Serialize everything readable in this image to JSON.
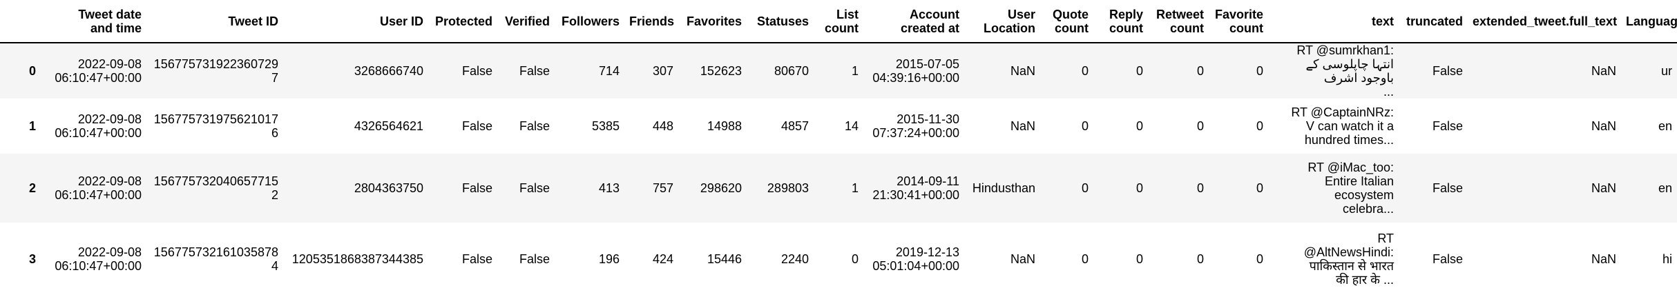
{
  "columns": {
    "index": "",
    "tweet_date": [
      "Tweet date",
      "and time"
    ],
    "tweet_id": "Tweet ID",
    "user_id": "User ID",
    "protected": "Protected",
    "verified": "Verified",
    "followers": "Followers",
    "friends": "Friends",
    "favorites": "Favorites",
    "statuses": "Statuses",
    "list_count": [
      "List",
      "count"
    ],
    "account_created": [
      "Account",
      "created at"
    ],
    "user_location": [
      "User",
      "Location"
    ],
    "quote_count": [
      "Quote",
      "count"
    ],
    "reply_count": [
      "Reply",
      "count"
    ],
    "retweet_count": [
      "Retweet",
      "count"
    ],
    "favorite_count": [
      "Favorite",
      "count"
    ],
    "text": "text",
    "truncated": "truncated",
    "extended_tweet": "extended_tweet.full_text",
    "language": "Language"
  },
  "rows": [
    {
      "index": "0",
      "tweet_date": [
        "2022-09-08",
        "06:10:47+00:00"
      ],
      "tweet_id": "1567757319223607297",
      "user_id": "3268666740",
      "protected": "False",
      "verified": "False",
      "followers": "714",
      "friends": "307",
      "favorites": "152623",
      "statuses": "80670",
      "list_count": "1",
      "account_created": [
        "2015-07-05",
        "04:39:16+00:00"
      ],
      "user_location": "NaN",
      "quote_count": "0",
      "reply_count": "0",
      "retweet_count": "0",
      "favorite_count": "0",
      "text": [
        "RT @sumrkhan1:",
        "انتہا چاپلوسی کے",
        "باوجود اشرف",
        "..."
      ],
      "truncated": "False",
      "extended_tweet": "NaN",
      "language": "ur"
    },
    {
      "index": "1",
      "tweet_date": [
        "2022-09-08",
        "06:10:47+00:00"
      ],
      "tweet_id": "1567757319756210176",
      "user_id": "4326564621",
      "protected": "False",
      "verified": "False",
      "followers": "5385",
      "friends": "448",
      "favorites": "14988",
      "statuses": "4857",
      "list_count": "14",
      "account_created": [
        "2015-11-30",
        "07:37:24+00:00"
      ],
      "user_location": "NaN",
      "quote_count": "0",
      "reply_count": "0",
      "retweet_count": "0",
      "favorite_count": "0",
      "text": [
        "RT @CaptainNRz:",
        "V can watch it a",
        "hundred times..."
      ],
      "truncated": "False",
      "extended_tweet": "NaN",
      "language": "en"
    },
    {
      "index": "2",
      "tweet_date": [
        "2022-09-08",
        "06:10:47+00:00"
      ],
      "tweet_id": "1567757320406577152",
      "user_id": "2804363750",
      "protected": "False",
      "verified": "False",
      "followers": "413",
      "friends": "757",
      "favorites": "298620",
      "statuses": "289803",
      "list_count": "1",
      "account_created": [
        "2014-09-11",
        "21:30:41+00:00"
      ],
      "user_location": "Hindusthan",
      "quote_count": "0",
      "reply_count": "0",
      "retweet_count": "0",
      "favorite_count": "0",
      "text": [
        "RT @iMac_too:",
        "Entire Italian",
        "ecosystem",
        "celebra..."
      ],
      "truncated": "False",
      "extended_tweet": "NaN",
      "language": "en"
    },
    {
      "index": "3",
      "tweet_date": [
        "2022-09-08",
        "06:10:47+00:00"
      ],
      "tweet_id": "1567757321610358784",
      "user_id": "1205351868387344385",
      "protected": "False",
      "verified": "False",
      "followers": "196",
      "friends": "424",
      "favorites": "15446",
      "statuses": "2240",
      "list_count": "0",
      "account_created": [
        "2019-12-13",
        "05:01:04+00:00"
      ],
      "user_location": "NaN",
      "quote_count": "0",
      "reply_count": "0",
      "retweet_count": "0",
      "favorite_count": "0",
      "text": [
        "RT",
        "@AltNewsHindi:",
        "पाकिस्तान से भारत",
        "की हार के ..."
      ],
      "truncated": "False",
      "extended_tweet": "NaN",
      "language": "hi"
    }
  ]
}
